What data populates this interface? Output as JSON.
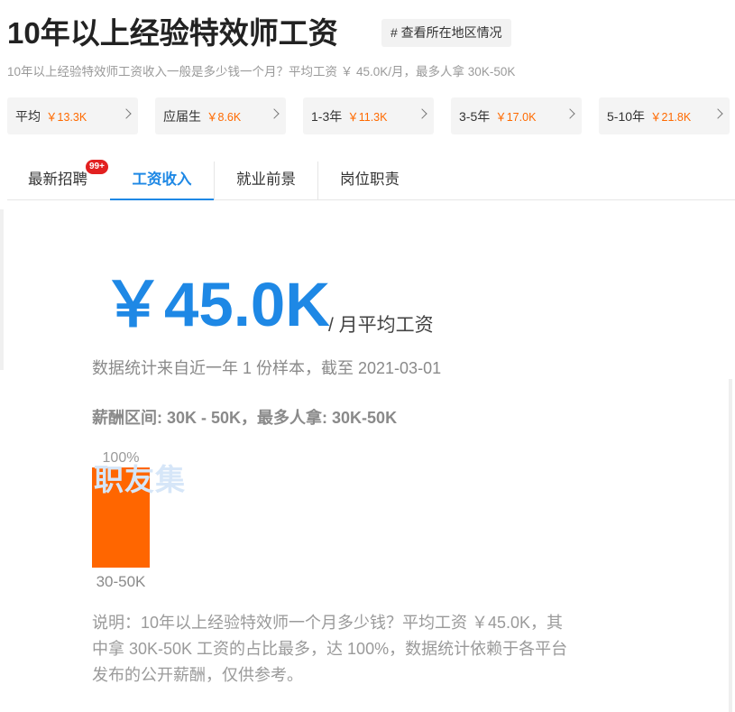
{
  "header": {
    "title": "10年以上经验特效师工资",
    "region_link": "# 查看所在地区情况",
    "subtitle": "10年以上经验特效师工资收入一般是多少钱一个月？平均工资 ￥ 45.0K/月，最多人拿 30K-50K"
  },
  "cards": [
    {
      "label": "平均",
      "value": "￥13.3K"
    },
    {
      "label": "应届生",
      "value": "￥8.6K"
    },
    {
      "label": "1-3年",
      "value": "￥11.3K"
    },
    {
      "label": "3-5年",
      "value": "￥17.0K"
    },
    {
      "label": "5-10年",
      "value": "￥21.8K"
    }
  ],
  "tabs": [
    {
      "label": "最新招聘",
      "badge": "99+"
    },
    {
      "label": "工资收入",
      "active": true
    },
    {
      "label": "就业前景"
    },
    {
      "label": "岗位职责"
    }
  ],
  "summary": {
    "salary": "￥45.0K",
    "suffix": "/ 月平均工资",
    "data_source": "数据统计来自近一年 1 份样本，截至 2021-03-01",
    "range_line": "薪酬区间: 30K - 50K，最多人拿: 30K-50K",
    "watermark": "职友集",
    "note": "说明：10年以上经验特效师一个月多少钱？平均工资 ￥45.0K，其中拿 30K-50K 工资的占比最多，达 100%，数据统计依赖于各平台发布的公开薪酬，仅供参考。"
  },
  "colors": {
    "accent": "#1e88e5",
    "highlight": "#ff6a00",
    "badge": "#e22020"
  },
  "chart_data": {
    "type": "bar",
    "categories": [
      "30-50K"
    ],
    "values": [
      100
    ],
    "data_labels": [
      "100%"
    ],
    "ylim": [
      0,
      100
    ],
    "bar_color": "#ff6600",
    "grid": false
  }
}
